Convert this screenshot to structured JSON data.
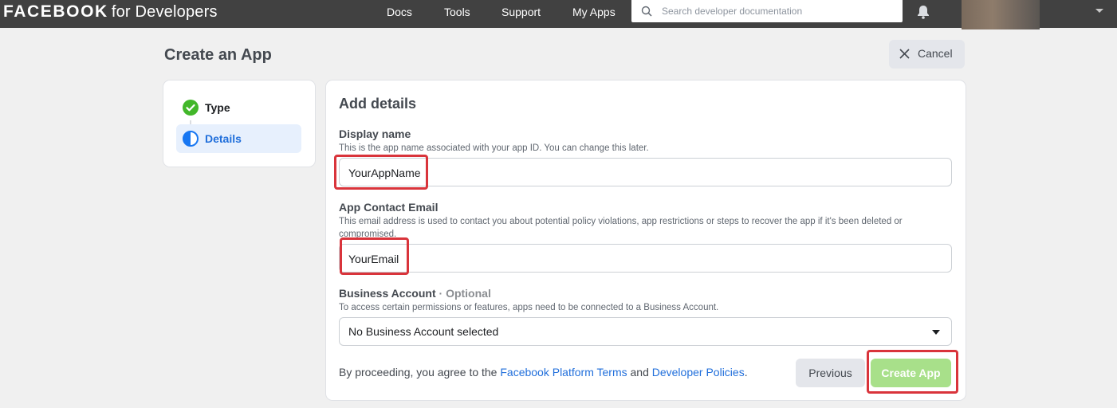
{
  "topbar": {
    "brand": "FACEBOOK",
    "brand_suffix": "for Developers",
    "nav": [
      "Docs",
      "Tools",
      "Support",
      "My Apps"
    ],
    "search_placeholder": "Search developer documentation",
    "icons": [
      "search-icon",
      "bell-icon",
      "chevron-down-icon"
    ]
  },
  "page": {
    "title": "Create an App",
    "cancel_label": "Cancel"
  },
  "steps": [
    {
      "label": "Type",
      "state": "complete",
      "icon": "check-circle-icon"
    },
    {
      "label": "Details",
      "state": "current",
      "icon": "half-circle-icon"
    }
  ],
  "form": {
    "title": "Add details",
    "display_name": {
      "label": "Display name",
      "help": "This is the app name associated with your app ID. You can change this later.",
      "value": "YourAppName"
    },
    "contact_email": {
      "label": "App Contact Email",
      "help": "This email address is used to contact you about potential policy violations, app restrictions or steps to recover the app if it's been deleted or compromised.",
      "value": "YourEmail"
    },
    "business_account": {
      "label": "Business Account",
      "optional": "· Optional",
      "help": "To access certain permissions or features, apps need to be connected to a Business Account.",
      "selected": "No Business Account selected"
    },
    "terms": {
      "prefix": "By proceeding, you agree to the ",
      "link1": "Facebook Platform Terms",
      "middle": " and ",
      "link2": "Developer Policies",
      "suffix": "."
    },
    "previous_label": "Previous",
    "create_label": "Create App"
  },
  "colors": {
    "topbar": "#414141",
    "link": "#216fdb",
    "create_button_disabled": "#a8e08a",
    "step_complete": "#42b72a",
    "step_current": "#1877f2",
    "highlight": "#d9343b"
  }
}
